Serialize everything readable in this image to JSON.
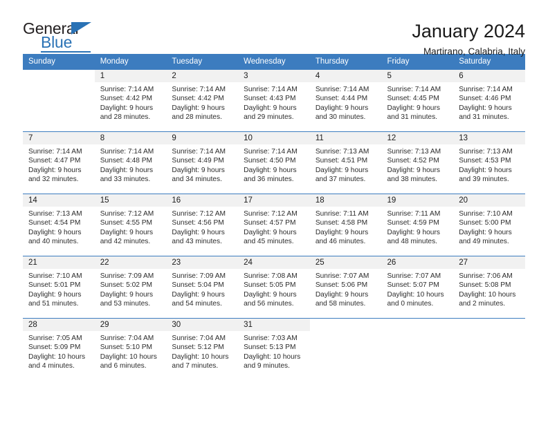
{
  "brand": {
    "name_part1": "General",
    "name_part2": "Blue"
  },
  "header": {
    "title": "January 2024",
    "subtitle": "Martirano, Calabria, Italy"
  },
  "weekday_headers": [
    "Sunday",
    "Monday",
    "Tuesday",
    "Wednesday",
    "Thursday",
    "Friday",
    "Saturday"
  ],
  "colors": {
    "header_blue": "#3c7cbf",
    "brand_blue": "#2a72b5",
    "daynum_band": "#f1f1f1",
    "text": "#1a1a1a"
  },
  "weeks": [
    [
      {
        "day": "",
        "sunrise": "",
        "sunset": "",
        "daylight": ""
      },
      {
        "day": "1",
        "sunrise": "Sunrise: 7:14 AM",
        "sunset": "Sunset: 4:42 PM",
        "daylight": "Daylight: 9 hours and 28 minutes."
      },
      {
        "day": "2",
        "sunrise": "Sunrise: 7:14 AM",
        "sunset": "Sunset: 4:42 PM",
        "daylight": "Daylight: 9 hours and 28 minutes."
      },
      {
        "day": "3",
        "sunrise": "Sunrise: 7:14 AM",
        "sunset": "Sunset: 4:43 PM",
        "daylight": "Daylight: 9 hours and 29 minutes."
      },
      {
        "day": "4",
        "sunrise": "Sunrise: 7:14 AM",
        "sunset": "Sunset: 4:44 PM",
        "daylight": "Daylight: 9 hours and 30 minutes."
      },
      {
        "day": "5",
        "sunrise": "Sunrise: 7:14 AM",
        "sunset": "Sunset: 4:45 PM",
        "daylight": "Daylight: 9 hours and 31 minutes."
      },
      {
        "day": "6",
        "sunrise": "Sunrise: 7:14 AM",
        "sunset": "Sunset: 4:46 PM",
        "daylight": "Daylight: 9 hours and 31 minutes."
      }
    ],
    [
      {
        "day": "7",
        "sunrise": "Sunrise: 7:14 AM",
        "sunset": "Sunset: 4:47 PM",
        "daylight": "Daylight: 9 hours and 32 minutes."
      },
      {
        "day": "8",
        "sunrise": "Sunrise: 7:14 AM",
        "sunset": "Sunset: 4:48 PM",
        "daylight": "Daylight: 9 hours and 33 minutes."
      },
      {
        "day": "9",
        "sunrise": "Sunrise: 7:14 AM",
        "sunset": "Sunset: 4:49 PM",
        "daylight": "Daylight: 9 hours and 34 minutes."
      },
      {
        "day": "10",
        "sunrise": "Sunrise: 7:14 AM",
        "sunset": "Sunset: 4:50 PM",
        "daylight": "Daylight: 9 hours and 36 minutes."
      },
      {
        "day": "11",
        "sunrise": "Sunrise: 7:13 AM",
        "sunset": "Sunset: 4:51 PM",
        "daylight": "Daylight: 9 hours and 37 minutes."
      },
      {
        "day": "12",
        "sunrise": "Sunrise: 7:13 AM",
        "sunset": "Sunset: 4:52 PM",
        "daylight": "Daylight: 9 hours and 38 minutes."
      },
      {
        "day": "13",
        "sunrise": "Sunrise: 7:13 AM",
        "sunset": "Sunset: 4:53 PM",
        "daylight": "Daylight: 9 hours and 39 minutes."
      }
    ],
    [
      {
        "day": "14",
        "sunrise": "Sunrise: 7:13 AM",
        "sunset": "Sunset: 4:54 PM",
        "daylight": "Daylight: 9 hours and 40 minutes."
      },
      {
        "day": "15",
        "sunrise": "Sunrise: 7:12 AM",
        "sunset": "Sunset: 4:55 PM",
        "daylight": "Daylight: 9 hours and 42 minutes."
      },
      {
        "day": "16",
        "sunrise": "Sunrise: 7:12 AM",
        "sunset": "Sunset: 4:56 PM",
        "daylight": "Daylight: 9 hours and 43 minutes."
      },
      {
        "day": "17",
        "sunrise": "Sunrise: 7:12 AM",
        "sunset": "Sunset: 4:57 PM",
        "daylight": "Daylight: 9 hours and 45 minutes."
      },
      {
        "day": "18",
        "sunrise": "Sunrise: 7:11 AM",
        "sunset": "Sunset: 4:58 PM",
        "daylight": "Daylight: 9 hours and 46 minutes."
      },
      {
        "day": "19",
        "sunrise": "Sunrise: 7:11 AM",
        "sunset": "Sunset: 4:59 PM",
        "daylight": "Daylight: 9 hours and 48 minutes."
      },
      {
        "day": "20",
        "sunrise": "Sunrise: 7:10 AM",
        "sunset": "Sunset: 5:00 PM",
        "daylight": "Daylight: 9 hours and 49 minutes."
      }
    ],
    [
      {
        "day": "21",
        "sunrise": "Sunrise: 7:10 AM",
        "sunset": "Sunset: 5:01 PM",
        "daylight": "Daylight: 9 hours and 51 minutes."
      },
      {
        "day": "22",
        "sunrise": "Sunrise: 7:09 AM",
        "sunset": "Sunset: 5:02 PM",
        "daylight": "Daylight: 9 hours and 53 minutes."
      },
      {
        "day": "23",
        "sunrise": "Sunrise: 7:09 AM",
        "sunset": "Sunset: 5:04 PM",
        "daylight": "Daylight: 9 hours and 54 minutes."
      },
      {
        "day": "24",
        "sunrise": "Sunrise: 7:08 AM",
        "sunset": "Sunset: 5:05 PM",
        "daylight": "Daylight: 9 hours and 56 minutes."
      },
      {
        "day": "25",
        "sunrise": "Sunrise: 7:07 AM",
        "sunset": "Sunset: 5:06 PM",
        "daylight": "Daylight: 9 hours and 58 minutes."
      },
      {
        "day": "26",
        "sunrise": "Sunrise: 7:07 AM",
        "sunset": "Sunset: 5:07 PM",
        "daylight": "Daylight: 10 hours and 0 minutes."
      },
      {
        "day": "27",
        "sunrise": "Sunrise: 7:06 AM",
        "sunset": "Sunset: 5:08 PM",
        "daylight": "Daylight: 10 hours and 2 minutes."
      }
    ],
    [
      {
        "day": "28",
        "sunrise": "Sunrise: 7:05 AM",
        "sunset": "Sunset: 5:09 PM",
        "daylight": "Daylight: 10 hours and 4 minutes."
      },
      {
        "day": "29",
        "sunrise": "Sunrise: 7:04 AM",
        "sunset": "Sunset: 5:10 PM",
        "daylight": "Daylight: 10 hours and 6 minutes."
      },
      {
        "day": "30",
        "sunrise": "Sunrise: 7:04 AM",
        "sunset": "Sunset: 5:12 PM",
        "daylight": "Daylight: 10 hours and 7 minutes."
      },
      {
        "day": "31",
        "sunrise": "Sunrise: 7:03 AM",
        "sunset": "Sunset: 5:13 PM",
        "daylight": "Daylight: 10 hours and 9 minutes."
      },
      {
        "day": "",
        "sunrise": "",
        "sunset": "",
        "daylight": ""
      },
      {
        "day": "",
        "sunrise": "",
        "sunset": "",
        "daylight": ""
      },
      {
        "day": "",
        "sunrise": "",
        "sunset": "",
        "daylight": ""
      }
    ]
  ]
}
